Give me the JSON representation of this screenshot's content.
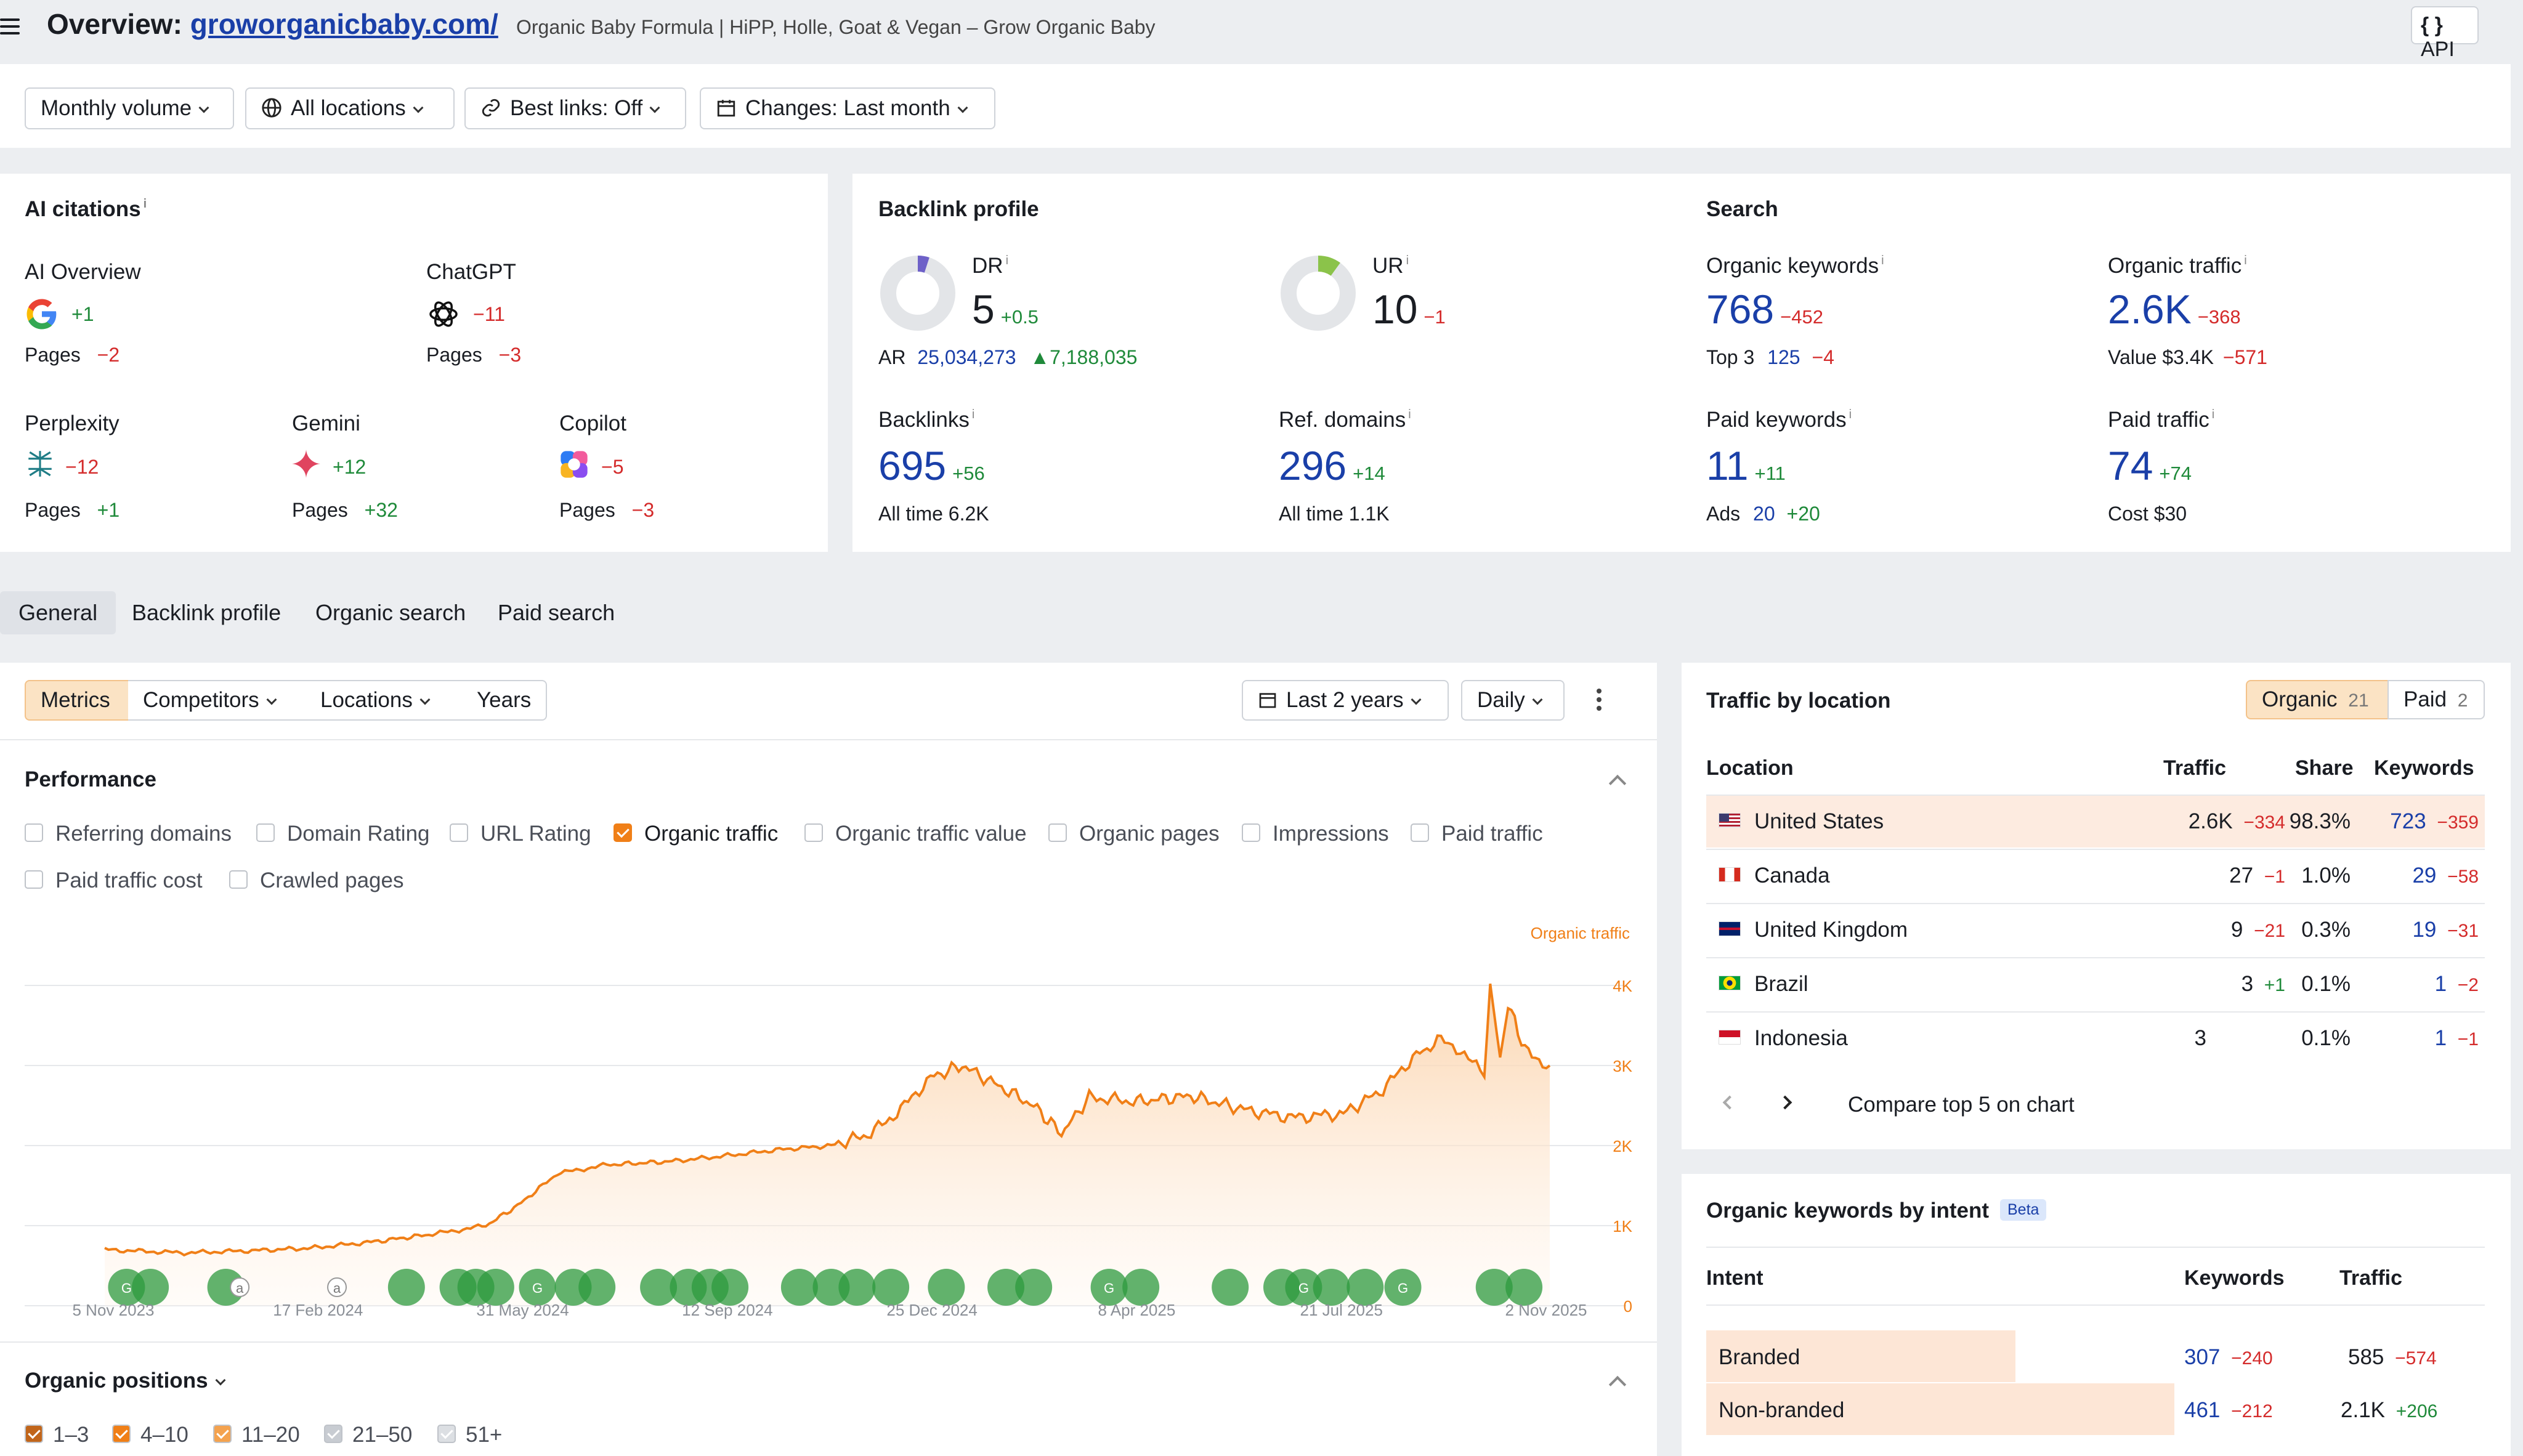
{
  "header": {
    "title_prefix": "Overview: ",
    "domain": "groworganicbaby.com/",
    "subtitle": "Organic Baby Formula | HiPP, Holle, Goat & Vegan – Grow Organic Baby",
    "api_label": "API"
  },
  "filters": {
    "volume": "Monthly volume",
    "locations": "All locations",
    "best_links": "Best links: Off",
    "changes": "Changes: Last month"
  },
  "ai_citations": {
    "title": "AI citations",
    "ai_overview": {
      "label": "AI Overview",
      "value": "+1",
      "pages_label": "Pages",
      "pages": "−2"
    },
    "chatgpt": {
      "label": "ChatGPT",
      "value": "−11",
      "pages_label": "Pages",
      "pages": "−3"
    },
    "perplexity": {
      "label": "Perplexity",
      "value": "−12",
      "pages_label": "Pages",
      "pages": "+1"
    },
    "gemini": {
      "label": "Gemini",
      "value": "+12",
      "pages_label": "Pages",
      "pages": "+32"
    },
    "copilot": {
      "label": "Copilot",
      "value": "−5",
      "pages_label": "Pages",
      "pages": "−3"
    }
  },
  "backlink_profile": {
    "title": "Backlink profile",
    "dr": {
      "label": "DR",
      "value": "5",
      "delta": "+0.5",
      "fill_fraction": 0.05
    },
    "ur": {
      "label": "UR",
      "value": "10",
      "delta": "−1",
      "fill_fraction": 0.1
    },
    "ar": {
      "label": "AR",
      "value": "25,034,273",
      "delta": "7,188,035"
    },
    "backlinks": {
      "label": "Backlinks",
      "value": "695",
      "delta": "+56",
      "sub_label": "All time",
      "sub_value": "6.2K"
    },
    "ref_domains": {
      "label": "Ref. domains",
      "value": "296",
      "delta": "+14",
      "sub_label": "All time",
      "sub_value": "1.1K"
    }
  },
  "search": {
    "title": "Search",
    "organic_keywords": {
      "label": "Organic keywords",
      "value": "768",
      "delta": "−452",
      "sub_label": "Top 3",
      "sub_value": "125",
      "sub_delta": "−4"
    },
    "organic_traffic": {
      "label": "Organic traffic",
      "value": "2.6K",
      "delta": "−368",
      "sub_label": "Value",
      "sub_value": "$3.4K",
      "sub_delta": "−571"
    },
    "paid_keywords": {
      "label": "Paid keywords",
      "value": "11",
      "delta": "+11",
      "sub_label": "Ads",
      "sub_value": "20",
      "sub_delta": "+20"
    },
    "paid_traffic": {
      "label": "Paid traffic",
      "value": "74",
      "delta": "+74",
      "sub_label": "Cost",
      "sub_value": "$30"
    }
  },
  "tabs": [
    "General",
    "Backlink profile",
    "Organic search",
    "Paid search"
  ],
  "toolbar": {
    "segments": [
      "Metrics",
      "Competitors",
      "Locations",
      "Years"
    ],
    "range": "Last 2 years",
    "granularity": "Daily"
  },
  "performance": {
    "title": "Performance",
    "checkboxes": [
      {
        "label": "Referring domains",
        "checked": false
      },
      {
        "label": "Domain Rating",
        "checked": false
      },
      {
        "label": "URL Rating",
        "checked": false
      },
      {
        "label": "Organic traffic",
        "checked": true
      },
      {
        "label": "Organic traffic value",
        "checked": false
      },
      {
        "label": "Organic pages",
        "checked": false
      },
      {
        "label": "Impressions",
        "checked": false
      },
      {
        "label": "Paid traffic",
        "checked": false
      },
      {
        "label": "Paid traffic cost",
        "checked": false
      },
      {
        "label": "Crawled pages",
        "checked": false
      }
    ]
  },
  "chart_data": {
    "type": "area",
    "series": [
      {
        "name": "Organic traffic",
        "color": "#f07f17"
      }
    ],
    "x_tick_labels": [
      "5 Nov 2023",
      "17 Feb 2024",
      "31 May 2024",
      "12 Sep 2024",
      "25 Dec 2024",
      "8 Apr 2025",
      "21 Jul 2025",
      "2 Nov 2025"
    ],
    "y_tick_labels": [
      "4K",
      "3K",
      "2K",
      "1K",
      "0"
    ],
    "ylim": [
      0,
      4000
    ],
    "x_range": [
      "2023-11-05",
      "2025-11-02"
    ],
    "points": [
      [
        "2023-11-05",
        700
      ],
      [
        "2023-12-15",
        660
      ],
      [
        "2024-01-20",
        690
      ],
      [
        "2024-02-17",
        720
      ],
      [
        "2024-03-20",
        800
      ],
      [
        "2024-04-20",
        900
      ],
      [
        "2024-05-15",
        1000
      ],
      [
        "2024-05-31",
        1250
      ],
      [
        "2024-06-20",
        1650
      ],
      [
        "2024-07-15",
        1760
      ],
      [
        "2024-08-15",
        1800
      ],
      [
        "2024-09-12",
        1870
      ],
      [
        "2024-10-10",
        1950
      ],
      [
        "2024-11-05",
        2000
      ],
      [
        "2024-11-25",
        2150
      ],
      [
        "2024-12-10",
        2450
      ],
      [
        "2024-12-25",
        2850
      ],
      [
        "2025-01-10",
        3000
      ],
      [
        "2025-01-28",
        2750
      ],
      [
        "2025-02-15",
        2500
      ],
      [
        "2025-03-01",
        2150
      ],
      [
        "2025-03-15",
        2600
      ],
      [
        "2025-04-08",
        2550
      ],
      [
        "2025-05-05",
        2620
      ],
      [
        "2025-06-01",
        2450
      ],
      [
        "2025-06-25",
        2350
      ],
      [
        "2025-07-21",
        2400
      ],
      [
        "2025-08-10",
        2700
      ],
      [
        "2025-08-25",
        3100
      ],
      [
        "2025-09-10",
        3350
      ],
      [
        "2025-09-22",
        3100
      ],
      [
        "2025-09-30",
        2850
      ],
      [
        "2025-10-03",
        4000
      ],
      [
        "2025-10-08",
        3100
      ],
      [
        "2025-10-12",
        3800
      ],
      [
        "2025-10-17",
        3400
      ],
      [
        "2025-10-24",
        3100
      ],
      [
        "2025-11-02",
        3000
      ]
    ],
    "event_markers": [
      {
        "date": "2023-11-16",
        "label": "G"
      },
      {
        "date": "2023-11-28",
        "label": ""
      },
      {
        "date": "2024-01-05",
        "label": ""
      },
      {
        "date": "2024-01-12",
        "label": "a"
      },
      {
        "date": "2024-03-01",
        "label": "a"
      },
      {
        "date": "2024-04-05",
        "label": ""
      },
      {
        "date": "2024-05-01",
        "label": ""
      },
      {
        "date": "2024-05-10",
        "label": ""
      },
      {
        "date": "2024-05-20",
        "label": ""
      },
      {
        "date": "2024-06-10",
        "label": "G"
      },
      {
        "date": "2024-06-28",
        "label": ""
      },
      {
        "date": "2024-07-10",
        "label": ""
      },
      {
        "date": "2024-08-10",
        "label": ""
      },
      {
        "date": "2024-08-25",
        "label": ""
      },
      {
        "date": "2024-09-05",
        "label": ""
      },
      {
        "date": "2024-09-15",
        "label": ""
      },
      {
        "date": "2024-10-20",
        "label": ""
      },
      {
        "date": "2024-11-05",
        "label": ""
      },
      {
        "date": "2024-11-18",
        "label": ""
      },
      {
        "date": "2024-12-05",
        "label": ""
      },
      {
        "date": "2025-01-02",
        "label": ""
      },
      {
        "date": "2025-02-01",
        "label": ""
      },
      {
        "date": "2025-02-15",
        "label": ""
      },
      {
        "date": "2025-03-25",
        "label": "G"
      },
      {
        "date": "2025-04-10",
        "label": ""
      },
      {
        "date": "2025-05-25",
        "label": ""
      },
      {
        "date": "2025-06-20",
        "label": ""
      },
      {
        "date": "2025-07-01",
        "label": "G"
      },
      {
        "date": "2025-07-15",
        "label": ""
      },
      {
        "date": "2025-08-01",
        "label": ""
      },
      {
        "date": "2025-08-20",
        "label": "G"
      },
      {
        "date": "2025-10-05",
        "label": ""
      },
      {
        "date": "2025-10-20",
        "label": ""
      }
    ]
  },
  "organic_positions": {
    "title": "Organic positions",
    "items": [
      {
        "label": "1–3",
        "color": "#c1651a"
      },
      {
        "label": "4–10",
        "color": "#f07f17"
      },
      {
        "label": "11–20",
        "color": "#f4a24e"
      },
      {
        "label": "21–50",
        "color": "#c8ccd2"
      },
      {
        "label": "51+",
        "color": "#dcdfe3"
      }
    ]
  },
  "traffic_by_location": {
    "title": "Traffic by location",
    "toggle": [
      {
        "label": "Organic",
        "count": "21"
      },
      {
        "label": "Paid",
        "count": "2"
      }
    ],
    "headers": [
      "Location",
      "Traffic",
      "Share",
      "Keywords"
    ],
    "rows": [
      {
        "country": "United States",
        "flag": "us",
        "traffic": "2.6K",
        "traffic_delta": "−334",
        "share": "98.3%",
        "keywords": "723",
        "keywords_delta": "−359"
      },
      {
        "country": "Canada",
        "flag": "ca",
        "traffic": "27",
        "traffic_delta": "−1",
        "share": "1.0%",
        "keywords": "29",
        "keywords_delta": "−58"
      },
      {
        "country": "United Kingdom",
        "flag": "gb",
        "traffic": "9",
        "traffic_delta": "−21",
        "share": "0.3%",
        "keywords": "19",
        "keywords_delta": "−31"
      },
      {
        "country": "Brazil",
        "flag": "br",
        "traffic": "3",
        "traffic_delta": "+1",
        "share": "0.1%",
        "keywords": "1",
        "keywords_delta": "−2"
      },
      {
        "country": "Indonesia",
        "flag": "id",
        "traffic": "3",
        "traffic_delta": "",
        "share": "0.1%",
        "keywords": "1",
        "keywords_delta": "−1"
      }
    ],
    "compare_label": "Compare top 5 on chart"
  },
  "intent": {
    "title": "Organic keywords by intent",
    "badge": "Beta",
    "headers": [
      "Intent",
      "Keywords",
      "Traffic"
    ],
    "rows": [
      {
        "label": "Branded",
        "keywords": "307",
        "keywords_delta": "−240",
        "traffic": "585",
        "traffic_delta": "−574"
      },
      {
        "label": "Non-branded",
        "keywords": "461",
        "keywords_delta": "−212",
        "traffic": "2.1K",
        "traffic_delta": "+206"
      }
    ]
  },
  "colors": {
    "accent": "#f07f17",
    "link": "#1a3fa8",
    "positive": "#1f8a3a",
    "negative": "#d42b2b"
  }
}
